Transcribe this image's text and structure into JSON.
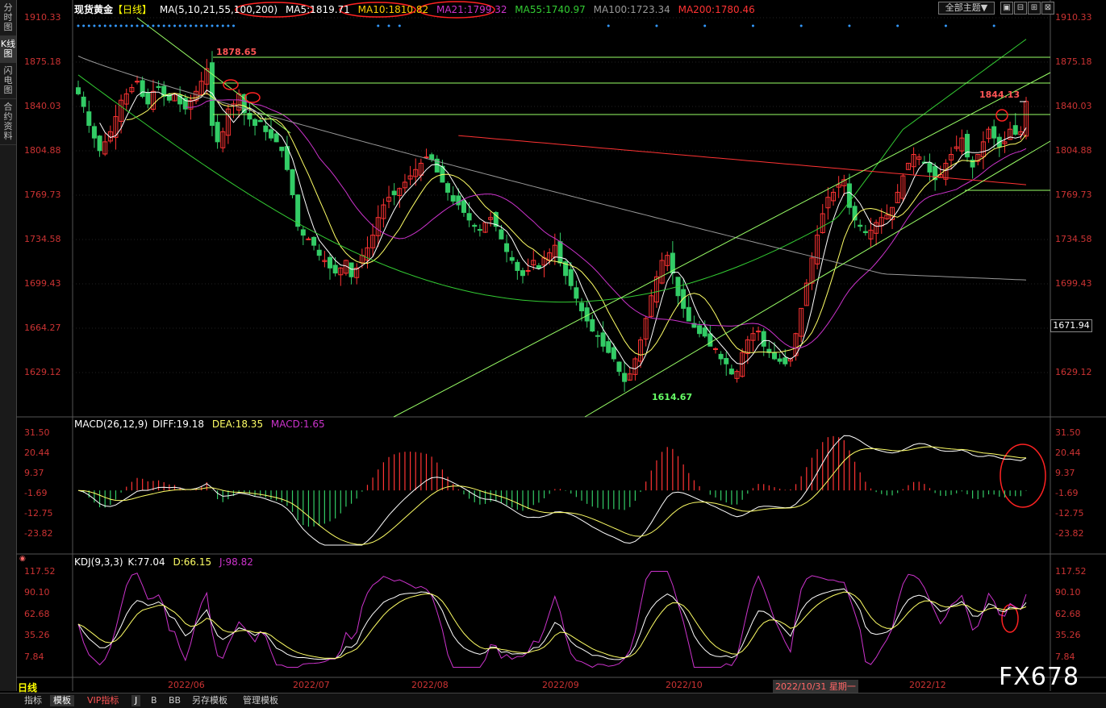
{
  "header": {
    "symbol": "现货黄金",
    "period": "【日线】",
    "ma_params": "MA(5,10,21,55,100,200)",
    "ma_values": [
      {
        "label": "MA5:1819.71",
        "color": "#ffffff"
      },
      {
        "label": "MA10:1810.82",
        "color": "#ffcc00"
      },
      {
        "label": "MA21:1799.32",
        "color": "#cc33cc"
      },
      {
        "label": "MA55:1740.97",
        "color": "#33cc33"
      },
      {
        "label": "MA100:1723.34",
        "color": "#999999"
      },
      {
        "label": "MA200:1780.46",
        "color": "#ff3333"
      }
    ],
    "theme_button": "全部主题▼",
    "window_buttons": [
      "▣",
      "⊟",
      "⊞",
      "⊠"
    ]
  },
  "sidebar": {
    "items": [
      {
        "label": "分时图",
        "active": false
      },
      {
        "label": "K线图",
        "active": true
      },
      {
        "label": "闪电图",
        "active": false
      },
      {
        "label": "合约资料",
        "active": false
      }
    ]
  },
  "price_axis": {
    "left_labels": [
      "1910.33",
      "1875.18",
      "1840.03",
      "1804.88",
      "1769.73",
      "1734.58",
      "1699.43",
      "1664.27",
      "1629.12"
    ],
    "right_labels": [
      "1910.33",
      "1875.18",
      "1840.03",
      "1804.88",
      "1769.73",
      "1734.58",
      "1699.43",
      "1629.12"
    ],
    "current_price": "1671.94"
  },
  "annotations": {
    "high_label": "1878.65",
    "low_label": "1614.67",
    "recent_label": "1844.13"
  },
  "macd": {
    "title": "MACD(26,12,9)",
    "diff": "DIFF:19.18",
    "dea": "DEA:18.35",
    "macd": "MACD:1.65",
    "labels": [
      "31.50",
      "20.44",
      "9.37",
      "-1.69",
      "-12.75",
      "-23.82"
    ]
  },
  "kdj": {
    "title": "KDJ(9,3,3)",
    "k": "K:77.04",
    "d": "D:66.15",
    "j": "J:98.82",
    "labels": [
      "117.52",
      "90.10",
      "62.68",
      "35.26",
      "7.84"
    ]
  },
  "x_axis": {
    "labels": [
      "2022/06",
      "2022/07",
      "2022/08",
      "2022/09",
      "2022/10",
      "2022/10/31 星期一",
      "2022/12"
    ]
  },
  "bottom_tabs": {
    "items": [
      "指标",
      "模板",
      "VIP指标",
      "J",
      "B",
      "BB",
      "另存模板",
      "管理模板"
    ],
    "active_index": 1
  },
  "period_label": "日线",
  "watermark": "FX678",
  "colors": {
    "up": "#ff3333",
    "down": "#33cc66",
    "ma5": "#ffffff",
    "ma10": "#ffff66",
    "ma21": "#cc33cc",
    "ma55": "#33cc33",
    "ma100": "#999999",
    "ma200": "#ff3333",
    "trend": "#99ff66",
    "circle": "#ff2222"
  },
  "chart_data": {
    "type": "candlestick",
    "price_range": [
      1610,
      1915
    ],
    "closes": [
      1850,
      1840,
      1825,
      1815,
      1805,
      1812,
      1820,
      1832,
      1845,
      1850,
      1855,
      1860,
      1848,
      1842,
      1852,
      1855,
      1848,
      1845,
      1850,
      1842,
      1838,
      1845,
      1852,
      1860,
      1870,
      1825,
      1812,
      1820,
      1838,
      1842,
      1850,
      1835,
      1830,
      1825,
      1828,
      1820,
      1815,
      1812,
      1805,
      1790,
      1770,
      1745,
      1738,
      1735,
      1730,
      1722,
      1718,
      1712,
      1708,
      1712,
      1718,
      1705,
      1712,
      1722,
      1728,
      1738,
      1752,
      1762,
      1768,
      1770,
      1775,
      1780,
      1785,
      1790,
      1795,
      1800,
      1798,
      1788,
      1780,
      1772,
      1765,
      1762,
      1756,
      1750,
      1745,
      1742,
      1748,
      1752,
      1745,
      1735,
      1725,
      1718,
      1710,
      1706,
      1710,
      1718,
      1712,
      1720,
      1724,
      1730,
      1716,
      1706,
      1698,
      1688,
      1678,
      1670,
      1662,
      1658,
      1650,
      1645,
      1640,
      1630,
      1622,
      1628,
      1640,
      1655,
      1672,
      1690,
      1705,
      1718,
      1722,
      1708,
      1690,
      1680,
      1670,
      1665,
      1660,
      1658,
      1650,
      1648,
      1640,
      1636,
      1628,
      1630,
      1645,
      1655,
      1660,
      1662,
      1650,
      1645,
      1640,
      1638,
      1636,
      1640,
      1660,
      1680,
      1700,
      1720,
      1738,
      1755,
      1768,
      1772,
      1778,
      1782,
      1760,
      1750,
      1745,
      1740,
      1742,
      1748,
      1752,
      1754,
      1760,
      1772,
      1785,
      1795,
      1802,
      1800,
      1795,
      1788,
      1782,
      1786,
      1795,
      1802,
      1808,
      1815,
      1800,
      1792,
      1802,
      1812,
      1822,
      1815,
      1808,
      1812,
      1822,
      1818,
      1820,
      1844
    ]
  }
}
